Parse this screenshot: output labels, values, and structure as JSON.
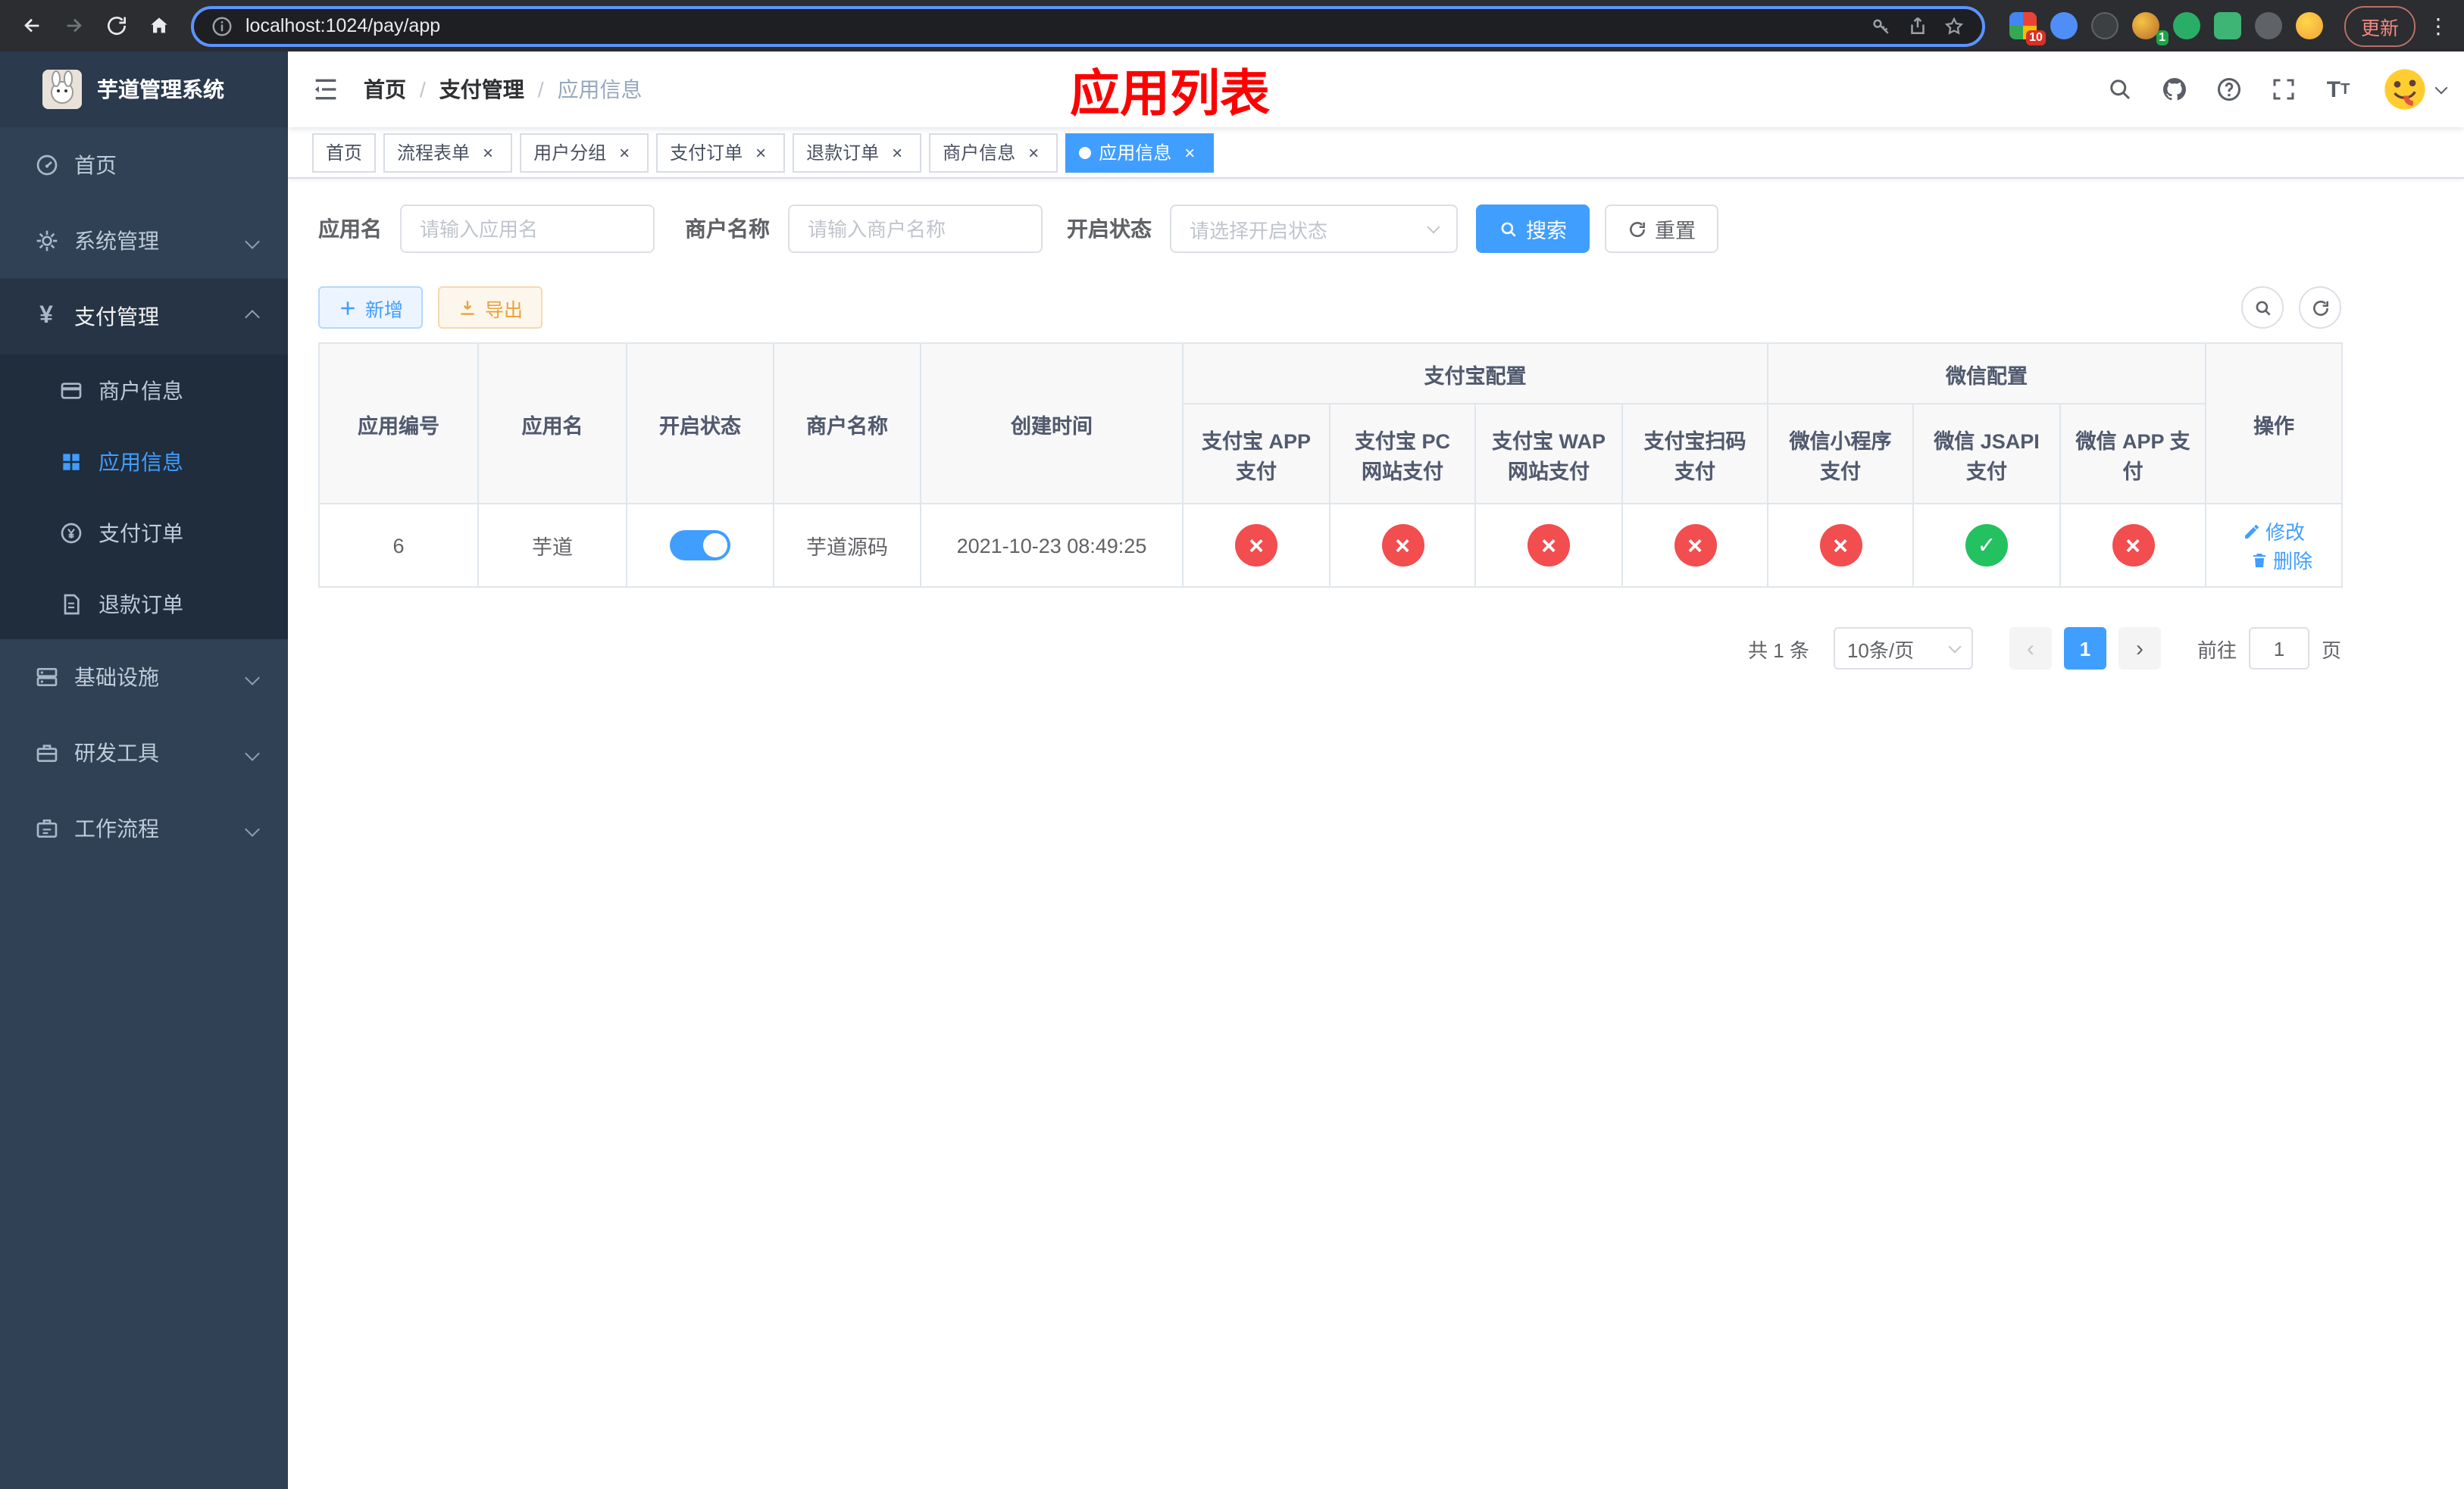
{
  "browser": {
    "url": "localhost:1024/pay/app",
    "update_label": "更新",
    "extension_badge_grid": "10",
    "extension_badge_avatar": "1"
  },
  "sidebar": {
    "title": "芋道管理系统",
    "items": [
      {
        "label": "首页"
      },
      {
        "label": "系统管理"
      },
      {
        "label": "支付管理"
      },
      {
        "label": "基础设施"
      },
      {
        "label": "研发工具"
      },
      {
        "label": "工作流程"
      }
    ],
    "submenu": [
      {
        "label": "商户信息"
      },
      {
        "label": "应用信息"
      },
      {
        "label": "支付订单"
      },
      {
        "label": "退款订单"
      }
    ]
  },
  "navbar": {
    "breadcrumb": [
      "首页",
      "支付管理",
      "应用信息"
    ],
    "separator": "/",
    "page_title": "应用列表"
  },
  "tabs": [
    {
      "label": "首页"
    },
    {
      "label": "流程表单"
    },
    {
      "label": "用户分组"
    },
    {
      "label": "支付订单"
    },
    {
      "label": "退款订单"
    },
    {
      "label": "商户信息"
    },
    {
      "label": "应用信息"
    }
  ],
  "filters": {
    "app_name": {
      "label": "应用名",
      "placeholder": "请输入应用名",
      "value": ""
    },
    "merchant_name": {
      "label": "商户名称",
      "placeholder": "请输入商户名称",
      "value": ""
    },
    "status": {
      "label": "开启状态",
      "placeholder": "请选择开启状态"
    },
    "search_button": "搜索",
    "reset_button": "重置"
  },
  "toolbar": {
    "add_button": "新增",
    "export_button": "导出"
  },
  "table": {
    "headers": {
      "app_id": "应用编号",
      "app_name": "应用名",
      "status": "开启状态",
      "merchant": "商户名称",
      "created": "创建时间",
      "alipay_group": "支付宝配置",
      "wechat_group": "微信配置",
      "alipay_app": "支付宝 APP 支付",
      "alipay_pc": "支付宝 PC 网站支付",
      "alipay_wap": "支付宝 WAP 网站支付",
      "alipay_qr": "支付宝扫码支付",
      "wx_lite": "微信小程序支付",
      "wx_jsapi": "微信 JSAPI 支付",
      "wx_app": "微信 APP 支付",
      "ops": "操作"
    },
    "row": {
      "app_id": "6",
      "app_name": "芋道",
      "enabled": true,
      "merchant": "芋道源码",
      "created": "2021-10-23 08:49:25",
      "channels": {
        "alipay_app": "off",
        "alipay_pc": "off",
        "alipay_wap": "off",
        "alipay_qr": "off",
        "wx_lite": "off",
        "wx_jsapi": "on",
        "wx_app": "off"
      },
      "edit_link": "修改",
      "delete_link": "删除"
    }
  },
  "pagination": {
    "total_text": "共 1 条",
    "page_size": "10条/页",
    "page": "1",
    "goto_prefix": "前往",
    "goto_value": "1",
    "goto_suffix": "页"
  },
  "colors": {
    "primary": "#409eff",
    "danger": "#f24d4f",
    "success": "#23c160",
    "title_red": "#ff0000"
  }
}
